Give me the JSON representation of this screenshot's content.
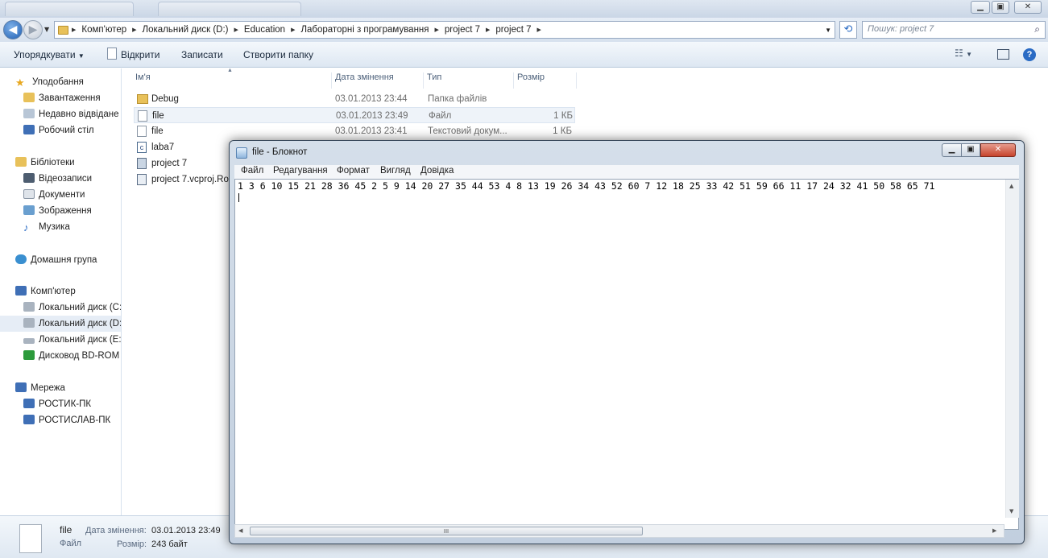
{
  "explorer": {
    "address": {
      "crumbs": [
        "Комп'ютер",
        "Локальний диск (D:)",
        "Education",
        "Лабораторні з програмування",
        "project 7",
        "project 7"
      ]
    },
    "search": {
      "placeholder": "Пошук: project 7"
    },
    "toolbar": {
      "organize": "Упорядкувати",
      "open": "Відкрити",
      "burn": "Записати",
      "new_folder": "Створити папку"
    },
    "sidebar": {
      "favorites": {
        "header": "Уподобання",
        "items": [
          "Завантаження",
          "Недавно відвідане",
          "Робочий стіл"
        ]
      },
      "libraries": {
        "header": "Бібліотеки",
        "items": [
          "Відеозаписи",
          "Документи",
          "Зображення",
          "Музика"
        ]
      },
      "homegroup": "Домашня група",
      "computer": {
        "header": "Комп'ютер",
        "items": [
          "Локальний диск (C:",
          "Локальний диск (D:",
          "Локальний диск (E:",
          "Дисковод BD-ROM"
        ]
      },
      "network": {
        "header": "Мережа",
        "items": [
          "РОСТИК-ПК",
          "РОСТИСЛАВ-ПК"
        ]
      }
    },
    "columns": {
      "name": "Ім'я",
      "date": "Дата змінення",
      "type": "Тип",
      "size": "Розмір"
    },
    "files": [
      {
        "name": "Debug",
        "date": "03.01.2013 23:44",
        "type": "Папка файлів",
        "size": "",
        "icon": "folder-icon"
      },
      {
        "name": "file",
        "date": "03.01.2013 23:49",
        "type": "Файл",
        "size": "1 КБ",
        "icon": "file-icon"
      },
      {
        "name": "file",
        "date": "03.01.2013 23:41",
        "type": "Текстовий докум...",
        "size": "1 КБ",
        "icon": "text-file-icon"
      },
      {
        "name": "laba7",
        "date": "",
        "type": "",
        "size": "",
        "icon": "c-source-icon"
      },
      {
        "name": "project 7",
        "date": "",
        "type": "",
        "size": "",
        "icon": "project-icon"
      },
      {
        "name": "project 7.vcproj.Ro",
        "date": "",
        "type": "",
        "size": "",
        "icon": "vcproj-icon"
      }
    ],
    "details": {
      "name": "file",
      "type": "Файл",
      "date_label": "Дата змінення:",
      "date_value": "03.01.2013 23:49",
      "size_label": "Розмір:",
      "size_value": "243 байт"
    }
  },
  "notepad": {
    "title": "file - Блокнот",
    "menu": [
      "Файл",
      "Редагування",
      "Формат",
      "Вигляд",
      "Довідка"
    ],
    "content": "1 3 6 10 15 21 28 36 45 2 5 9 14 20 27 35 44 53 4 8 13 19 26 34 43 52 60 7 12 18 25 33 42 51 59 66 11 17 24 32 41 50 58 65 71",
    "hscroll_thumb": "III"
  },
  "colors": {
    "selection": "#e6edf6",
    "accent": "#2a6bc4",
    "folder": "#e8c15a",
    "close": "#c6432c"
  }
}
